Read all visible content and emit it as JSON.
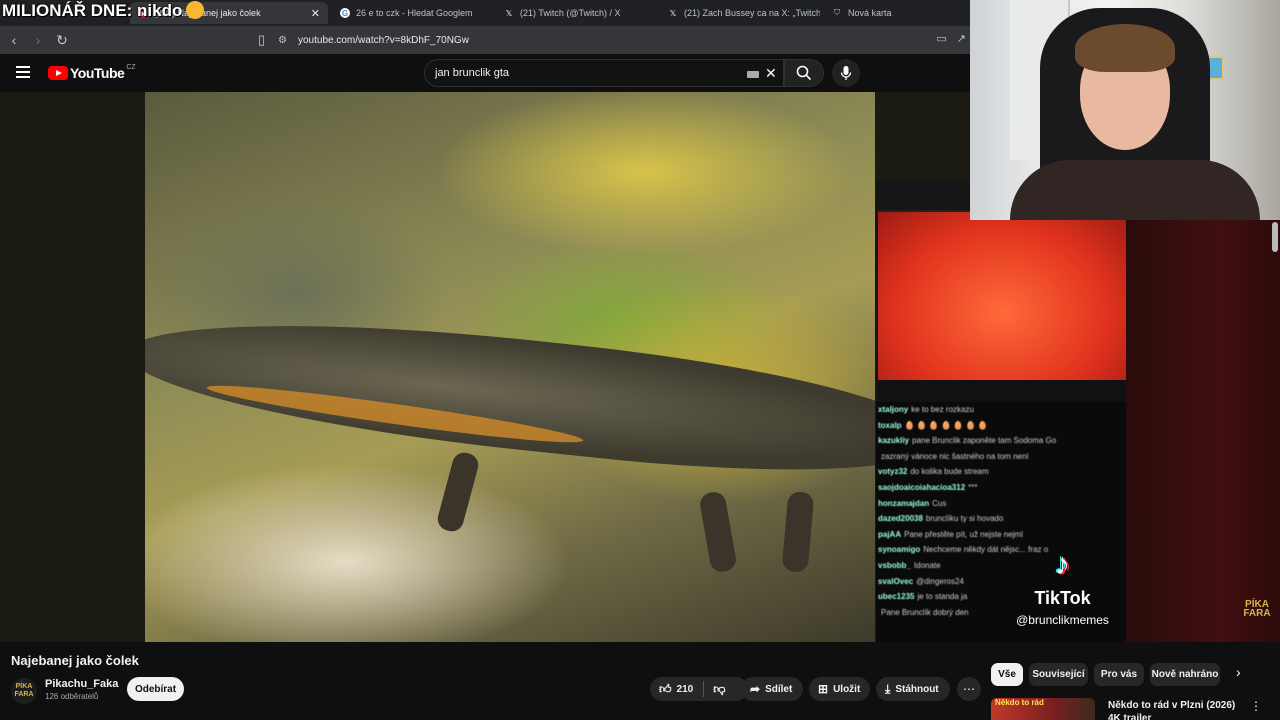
{
  "overlay": {
    "title": "MILIONÁŘ DNE: nikdo"
  },
  "browser": {
    "tabs": [
      {
        "label": "(338) Najebanej jako čolek",
        "active": true
      },
      {
        "label": "26 e to czk - Hledat Googlem"
      },
      {
        "label": "(21) Twitch (@Twitch) / X"
      },
      {
        "label": "(21) Zach Bussey ca na X: „Twitch info"
      },
      {
        "label": "Nová karta"
      }
    ],
    "url": "youtube.com/watch?v=8kDhF_70NGw"
  },
  "youtube": {
    "logo_text": "YouTube",
    "region": "CZ",
    "search_query": "jan brunclik gta"
  },
  "stream": {
    "chat_lines": [
      {
        "user": "xtaljony",
        "text": "ke to bez rozkazu"
      },
      {
        "user": "toxalp",
        "text": "🥚 🥚 🥚 🥚 🥚 🥚 🥚"
      },
      {
        "user": "kazukliy",
        "text": "pane Brunclik zaponěte tam Sodoma Go"
      },
      {
        "user": "",
        "text": "zazraný vánoce nic šastného na tom není"
      },
      {
        "user": "votyz32",
        "text": "do kolika bude stream"
      },
      {
        "user": "saojdoaicoiahacioa312",
        "text": "***"
      },
      {
        "user": "honzamajdan",
        "text": "Cus"
      },
      {
        "user": "dazed20038",
        "text": "brunclíku ty si hovado"
      },
      {
        "user": "pajAA",
        "text": "Pane přestěte pít, už nejste nejml"
      },
      {
        "user": "synoamigo",
        "text": "Nechceme někdy dát nějsc... fraz o"
      },
      {
        "user": "vsbobb_",
        "text": "Idonate"
      },
      {
        "user": "svalOvec",
        "text": "@dingeros24"
      },
      {
        "user": "ubec1235",
        "text": "je to standa ja"
      },
      {
        "user": "",
        "text": "Pane Brunclík dobrý den"
      }
    ],
    "tiktok_name": "TikTok",
    "tiktok_handle": "@brunclikmemes",
    "watermark": "PÍKA FARA"
  },
  "video": {
    "title": "Najebanej jako čolek",
    "channel": "Pikachu_Faka",
    "subscribers": "126 odběratelů",
    "subscribe_label": "Odebírat",
    "likes": "210",
    "share_label": "Sdílet",
    "save_label": "Uložit",
    "download_label": "Stáhnout"
  },
  "chips": [
    "Vše",
    "Související",
    "Pro vás",
    "Nově nahráno"
  ],
  "recommendation": {
    "thumb_text": "Někdo to rád",
    "title": "Někdo to rád v Plzni (2026) 4K trailer"
  }
}
